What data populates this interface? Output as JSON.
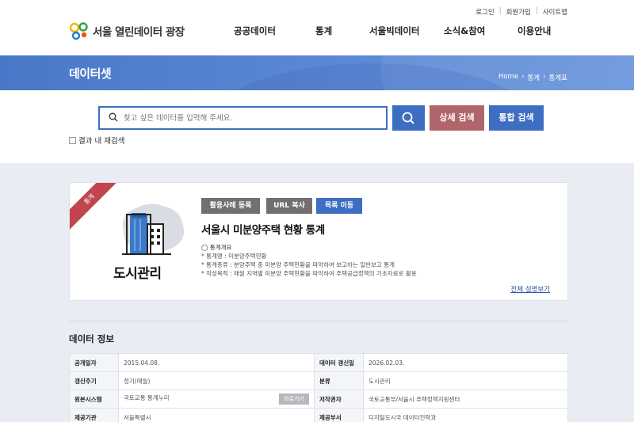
{
  "header": {
    "util_links": [
      "로그인",
      "회원가입",
      "사이트맵"
    ],
    "logo_text": "서울 열린데이터 광장",
    "nav": [
      "공공데이터",
      "통계",
      "서울빅데이터",
      "소식&참여",
      "이용안내"
    ]
  },
  "banner": {
    "title": "데이터셋",
    "breadcrumb": [
      "Home",
      "통계",
      "통계표"
    ]
  },
  "search": {
    "placeholder": "찾고 싶은 데이터를 입력해 주세요.",
    "detail_label": "상세 검색",
    "total_label": "통합 검색",
    "research_label": "결과 내 재검색"
  },
  "card": {
    "ribbon": "통계",
    "category": "도시관리",
    "buttons": [
      "활용사례 등록",
      "URL 복사",
      "목록 이동"
    ],
    "title": "서울시 미분양주택 현황 통계",
    "desc_head": "◯ 통계개요",
    "desc_lines": [
      "* 통계명 : 미분양주택현황",
      "* 통계종류 : 분양주택 중 미분양 주택현황을 파악하여 보고하는 일반보고 통계",
      "* 작성목적 : 매월 지역별 미분양 주택현황을 파악하여 주택공급정책의 기초자료로 활용"
    ],
    "more_label": "전체 설명보기"
  },
  "info": {
    "title": "데이터 정보",
    "rows": [
      [
        "공개일자",
        "2015.04.08.",
        "데이터 갱신일",
        "2026.02.03."
      ],
      [
        "갱신주기",
        "정기(매월)",
        "분류",
        "도시관리"
      ],
      [
        "원본시스템",
        "국토교통 통계누리",
        "저작권자",
        "국토교통부/서울시 주택정책지원센터"
      ],
      [
        "제공기관",
        "서울특별시",
        "제공부서",
        "디지털도시국 데이터전략과"
      ]
    ],
    "go_label": "바로가기"
  }
}
